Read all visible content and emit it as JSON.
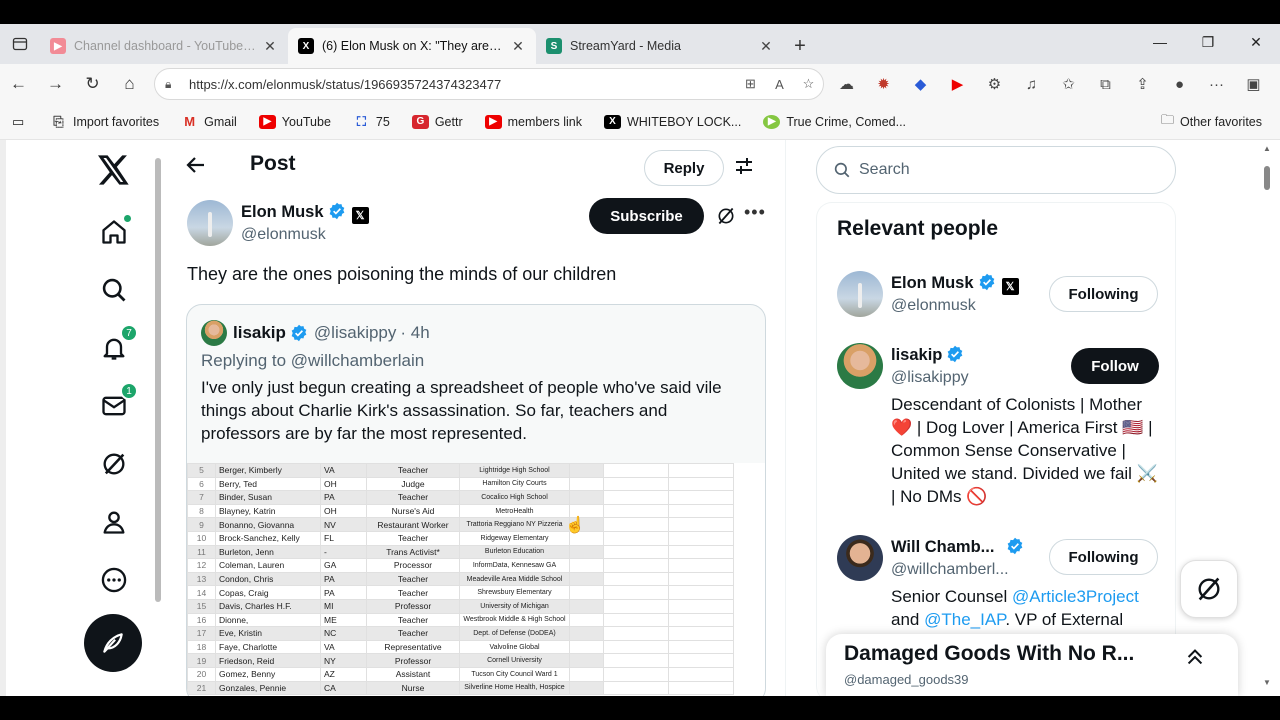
{
  "tabs": [
    {
      "title": "Channel dashboard - YouTube Studio",
      "favicon": "youtube-studio-icon",
      "active": false
    },
    {
      "title": "(6) Elon Musk on X: \"They are the ones poisoning the minds of our children\"",
      "favicon": "x-icon",
      "active": true
    },
    {
      "title": "StreamYard - Media",
      "favicon": "streamyard-icon",
      "active": false
    }
  ],
  "address": {
    "url": "https://x.com/elonmusk/status/1966935724374323477"
  },
  "favorites": [
    {
      "label": "Import favorites",
      "icon": "import-icon"
    },
    {
      "label": "Gmail",
      "icon": "gmail-icon"
    },
    {
      "label": "YouTube",
      "icon": "youtube-icon"
    },
    {
      "label": "75",
      "icon": "app-icon"
    },
    {
      "label": "Gettr",
      "icon": "gettr-icon"
    },
    {
      "label": "members link",
      "icon": "youtube-icon"
    },
    {
      "label": "WHITEBOY LOCK...",
      "icon": "x-icon"
    },
    {
      "label": "True Crime, Comed...",
      "icon": "rumble-icon"
    }
  ],
  "other_favorites": "Other favorites",
  "nav": {
    "notifications_badge": "7",
    "messages_badge": "1"
  },
  "post_header": {
    "title": "Post",
    "reply_label": "Reply"
  },
  "post": {
    "author_name": "Elon Musk",
    "author_handle": "@elonmusk",
    "subscribe_label": "Subscribe",
    "text": "They are the ones poisoning the minds of our children"
  },
  "quote": {
    "name": "lisakip",
    "handle": "@lisakippy",
    "time": "· 4h",
    "replying_to": "Replying to @willchamberlain",
    "text": "I've only just begun creating a spreadsheet of people who've said vile things about Charlie Kirk's assassination. So far, teachers and professors are by far the most represented."
  },
  "spreadsheet": [
    [
      "5",
      "Berger, Kimberly",
      "VA",
      "Teacher",
      "Lightridge High School"
    ],
    [
      "6",
      "Berry, Ted",
      "OH",
      "Judge",
      "Hamilton City Courts"
    ],
    [
      "7",
      "Binder, Susan",
      "PA",
      "Teacher",
      "Cocalico High School"
    ],
    [
      "8",
      "Blayney, Katrin",
      "OH",
      "Nurse's Aid",
      "MetroHealth"
    ],
    [
      "9",
      "Bonanno, Giovanna",
      "NV",
      "Restaurant Worker",
      "Trattoria Reggiano NY Pizzeria"
    ],
    [
      "10",
      "Brock-Sanchez, Kelly",
      "FL",
      "Teacher",
      "Ridgeway Elementary"
    ],
    [
      "11",
      "Burleton, Jenn",
      "-",
      "Trans Activist*",
      "Burleton Education"
    ],
    [
      "12",
      "Coleman, Lauren",
      "GA",
      "Processor",
      "InformData, Kennesaw GA"
    ],
    [
      "13",
      "Condon, Chris",
      "PA",
      "Teacher",
      "Meadeville Area Middle School"
    ],
    [
      "14",
      "Copas, Craig",
      "PA",
      "Teacher",
      "Shrewsbury Elementary"
    ],
    [
      "15",
      "Davis, Charles H.F.",
      "MI",
      "Professor",
      "University of Michigan"
    ],
    [
      "16",
      "Dionne,",
      "ME",
      "Teacher",
      "Westbrook Middle & High School"
    ],
    [
      "17",
      "Eve, Kristin",
      "NC",
      "Teacher",
      "Dept. of Defense (DoDEA)"
    ],
    [
      "18",
      "Faye, Charlotte",
      "VA",
      "Representative",
      "Valvoline Global"
    ],
    [
      "19",
      "Friedson, Reid",
      "NY",
      "Professor",
      "Cornell University"
    ],
    [
      "20",
      "Gomez, Benny",
      "AZ",
      "Assistant",
      "Tucson City Council Ward 1"
    ],
    [
      "21",
      "Gonzales, Pennie",
      "CA",
      "Nurse",
      "Silverline Home Health, Hospice"
    ]
  ],
  "search": {
    "placeholder": "Search"
  },
  "relevant": {
    "title": "Relevant people",
    "people": [
      {
        "name": "Elon Musk",
        "handle": "@elonmusk",
        "button": "Following",
        "bio": ""
      },
      {
        "name": "lisakip",
        "handle": "@lisakippy",
        "button": "Follow",
        "bio": "Descendant of Colonists | Mother ❤️ | Dog Lover | America First 🇺🇸 | Common Sense Conservative | United we stand. Divided we fail ⚔️ | No DMs 🚫"
      },
      {
        "name": "Will Chamb...",
        "handle": "@willchamberl...",
        "button": "Following",
        "bio_prefix": "Senior Counsel ",
        "bio_link1": "@Article3Project",
        "bio_mid": " and ",
        "bio_link2": "@The_IAP",
        "bio_suffix": ". VP of External"
      }
    ]
  },
  "messages_drawer": {
    "title": "Damaged Goods With No R...",
    "handle": "@damaged_goods39"
  },
  "colors": {
    "x_black": "#0f1419",
    "verified_blue": "#1d9bf0",
    "badge_green": "#1ca56a",
    "tab_bg": "#e4e6ea"
  }
}
